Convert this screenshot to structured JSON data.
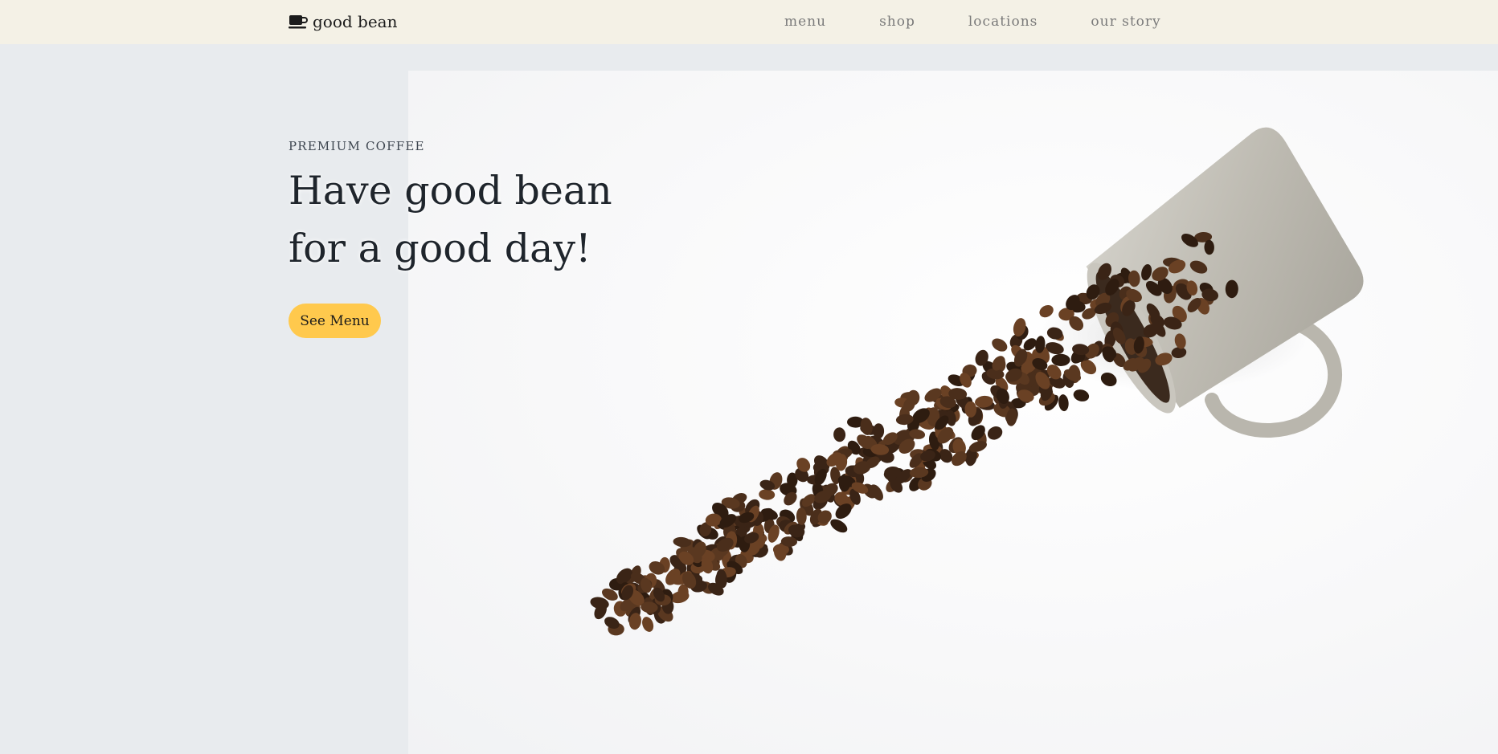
{
  "navbar": {
    "brand_icon": "coffee-cup-icon",
    "brand_label": "good bean",
    "links": [
      "menu",
      "shop",
      "locations",
      "our story"
    ]
  },
  "hero": {
    "eyebrow": "PREMIUM COFFEE",
    "headline_line1": "Have good bean",
    "headline_line2": "for a good day!",
    "cta_label": "See Menu",
    "image": "spilled-coffee-beans-mug-photo"
  },
  "colors": {
    "navbar_bg": "#f4f1e6",
    "page_bg": "#e8ebee",
    "cta_bg": "#ffc94d",
    "text_dark": "#1f252c",
    "nav_text": "#7a7a7a"
  }
}
